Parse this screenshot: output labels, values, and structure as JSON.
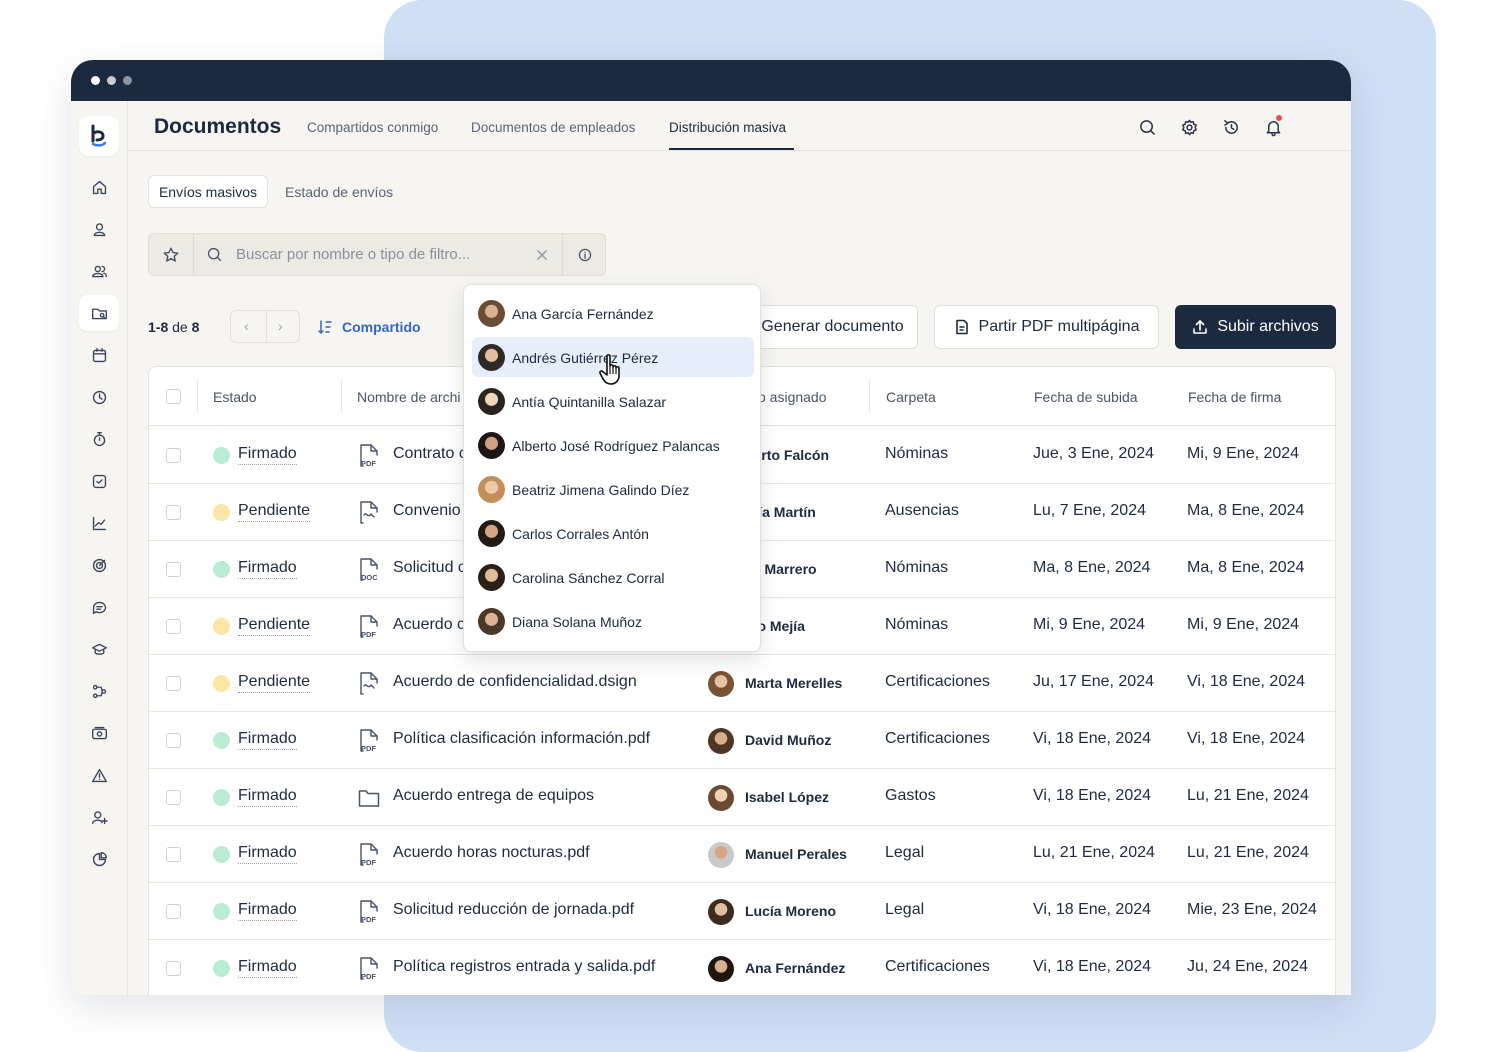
{
  "app": {
    "title": "Documentos"
  },
  "nav": {
    "tabs": [
      {
        "label": "Compartidos conmigo"
      },
      {
        "label": "Documentos de empleados"
      },
      {
        "label": "Distribución masiva"
      }
    ]
  },
  "subtabs": {
    "active": "Envíos masivos",
    "other": "Estado de envíos"
  },
  "search": {
    "placeholder": "Buscar por nombre o tipo de filtro..."
  },
  "pagination": {
    "range": "1-8",
    "of": "de",
    "total": "8"
  },
  "sort": {
    "label": "Compartido"
  },
  "actions": {
    "generate": "Generar documento",
    "split": "Partir PDF multipágina",
    "upload": "Subir archivos"
  },
  "columns": {
    "estado": "Estado",
    "nombre": "Nombre de archi",
    "asignado": "o asignado",
    "carpeta": "Carpeta",
    "subida": "Fecha de subida",
    "firma": "Fecha de firma"
  },
  "colors": {
    "firmado": "#b9ecd3",
    "pendiente": "#fbe6a6",
    "accent": "#3466c2",
    "dark": "#1c2a3f"
  },
  "rows": [
    {
      "status": "Firmado",
      "file_icon": "pdf-icon",
      "file": "Contrato c",
      "person": "berto Falcón",
      "folder": "Nóminas",
      "uploaded": "Jue, 3 Ene, 2024",
      "signed": "Mi, 9 Ene, 2024"
    },
    {
      "status": "Pendiente",
      "file_icon": "sign-doc-icon",
      "file": "Convenio",
      "person": "aría Martín",
      "folder": "Ausencias",
      "uploaded": "Lu, 7 Ene, 2024",
      "signed": "Ma, 8 Ene, 2024"
    },
    {
      "status": "Firmado",
      "file_icon": "doc-icon",
      "file": "Solicitud c",
      "person": "se Marrero",
      "folder": "Nóminas",
      "uploaded": "Ma, 8 Ene, 2024",
      "signed": "Ma, 8 Ene, 2024"
    },
    {
      "status": "Pendiente",
      "file_icon": "pdf-icon",
      "file": "Acuerdo c",
      "person": "blo Mejía",
      "folder": "Nóminas",
      "uploaded": "Mi, 9 Ene, 2024",
      "signed": "Mi, 9 Ene, 2024"
    },
    {
      "status": "Pendiente",
      "file_icon": "sign-doc-icon",
      "file": "Acuerdo de confidencialidad.dsign",
      "person": "Marta Merelles",
      "folder": "Certificaciones",
      "uploaded": "Ju, 17 Ene, 2024",
      "signed": "Vi, 18 Ene, 2024"
    },
    {
      "status": "Firmado",
      "file_icon": "pdf-icon",
      "file": "Política clasificación información.pdf",
      "person": "David Muñoz",
      "folder": "Certificaciones",
      "uploaded": "Vi, 18 Ene, 2024",
      "signed": "Vi, 18 Ene, 2024"
    },
    {
      "status": "Firmado",
      "file_icon": "folder-icon",
      "file": "Acuerdo entrega de equipos",
      "person": "Isabel López",
      "folder": "Gastos",
      "uploaded": "Vi, 18 Ene, 2024",
      "signed": "Lu, 21 Ene, 2024"
    },
    {
      "status": "Firmado",
      "file_icon": "pdf-icon",
      "file": "Acuerdo horas nocturas.pdf",
      "person": "Manuel Perales",
      "folder": "Legal",
      "uploaded": "Lu, 21 Ene, 2024",
      "signed": "Lu, 21 Ene, 2024"
    },
    {
      "status": "Firmado",
      "file_icon": "pdf-icon",
      "file": "Solicitud reducción de jornada.pdf",
      "person": "Lucía Moreno",
      "folder": "Legal",
      "uploaded": "Vi, 18 Ene, 2024",
      "signed": "Mie, 23 Ene, 2024"
    },
    {
      "status": "Firmado",
      "file_icon": "pdf-icon",
      "file": "Política registros entrada y salida.pdf",
      "person": "Ana Fernández",
      "folder": "Certificaciones",
      "uploaded": "Vi, 18 Ene, 2024",
      "signed": "Ju, 24 Ene, 2024"
    }
  ],
  "dropdown": {
    "items": [
      {
        "name": "Ana García Fernández"
      },
      {
        "name": "Andrés Gutiérrez Pérez"
      },
      {
        "name": "Antía Quintanilla Salazar"
      },
      {
        "name": "Alberto José Rodríguez Palancas"
      },
      {
        "name": "Beatriz Jimena Galindo Díez"
      },
      {
        "name": "Carlos Corrales Antón"
      },
      {
        "name": "Carolina Sánchez Corral"
      },
      {
        "name": "Diana Solana Muñoz"
      }
    ]
  }
}
